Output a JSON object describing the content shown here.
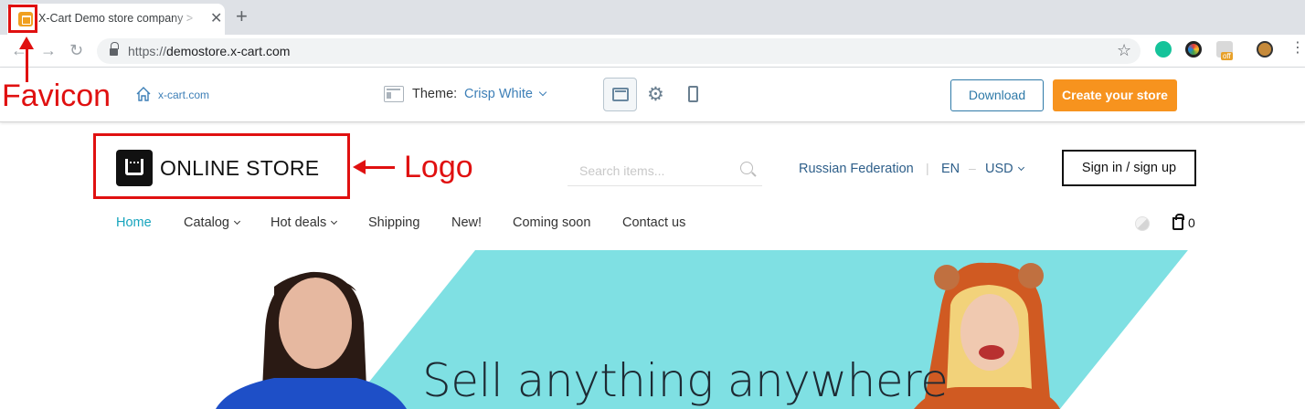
{
  "browser": {
    "tab_title": "X-Cart Demo store company >",
    "tab_close": "✕",
    "new_tab": "+",
    "url_scheme": "https://",
    "url_host": "demostore.x-cart.com",
    "ext_badge": "off"
  },
  "demo_bar": {
    "home_link": "x-cart.com",
    "theme_label": "Theme:",
    "theme_value": "Crisp White",
    "download_label": "Download",
    "create_store_label": "Create your store"
  },
  "store": {
    "logo_text": "ONLINE STORE",
    "search_placeholder": "Search items...",
    "country": "Russian Federation",
    "language": "EN",
    "currency": "USD",
    "signin_label": "Sign in / sign up",
    "cart_count": "0"
  },
  "nav": {
    "items": [
      {
        "label": "Home",
        "active": true
      },
      {
        "label": "Catalog",
        "dropdown": true
      },
      {
        "label": "Hot deals",
        "dropdown": true
      },
      {
        "label": "Shipping"
      },
      {
        "label": "New!"
      },
      {
        "label": "Coming soon"
      },
      {
        "label": "Contact us"
      }
    ]
  },
  "hero": {
    "headline": "Sell anything anywhere"
  },
  "annotations": {
    "favicon": "Favicon",
    "logo": "Logo"
  },
  "colors": {
    "accent_orange": "#f7931e",
    "link_blue": "#3d7fb7",
    "nav_active": "#16a4bd",
    "annotation_red": "#e01010",
    "hero_teal": "#7fe0e3"
  }
}
